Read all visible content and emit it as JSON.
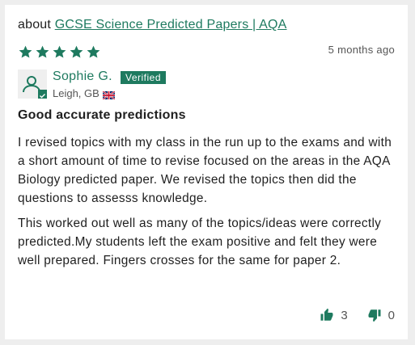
{
  "review": {
    "about_prefix": "about",
    "product_link": "GCSE Science Predicted Papers | AQA",
    "rating": 5,
    "time_ago": "5 months ago",
    "reviewer_name": "Sophie G.",
    "verified_label": "Verified",
    "location": "Leigh, GB",
    "title": "Good accurate predictions",
    "paragraphs": [
      "I revised topics with my class in the run up to the exams and with a short amount of time to revise focused on the areas in the AQA Biology predicted paper. We revised the topics then did the questions to assesss knowledge.",
      "This worked out well as many of the topics/ideas were correctly predicted.My students left the exam positive and felt they were well prepared. Fingers crosses for the same for paper 2."
    ],
    "helpful_count": "3",
    "unhelpful_count": "0"
  },
  "colors": {
    "accent": "#1e7a5f",
    "background": "#eeeeee",
    "card": "#ffffff"
  },
  "icons": {
    "star": "star-icon",
    "avatar": "user-icon",
    "flag": "uk-flag-icon",
    "thumbs_up": "thumbs-up-icon",
    "thumbs_down": "thumbs-down-icon"
  }
}
